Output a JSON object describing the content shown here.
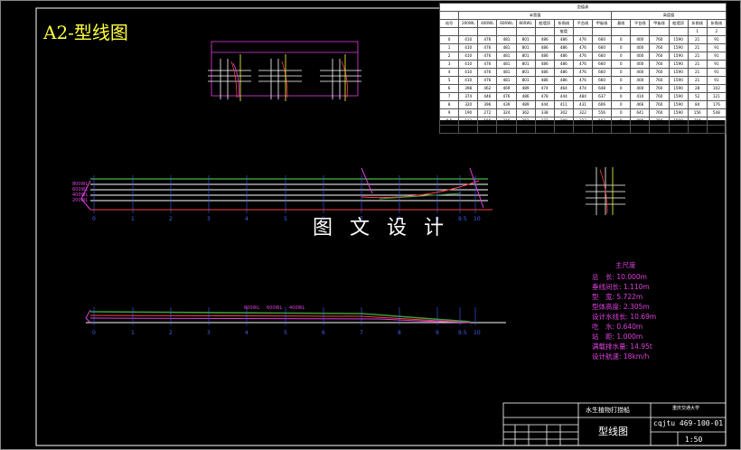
{
  "sheet_title": "A2-型线图",
  "watermark": "图 文 设 计",
  "offsets_table": {
    "title": "型值表",
    "group_left": "半宽值",
    "group_right": "高度值",
    "headers": [
      "站号",
      "200WL",
      "400WL",
      "600WL",
      "800WL",
      "舷墙顶",
      "折角线",
      "平台线",
      "甲板线",
      "基线",
      "平台线",
      "甲板线",
      "舷墙顶",
      "折角线",
      "折角线"
    ],
    "headers2": [
      "",
      "",
      "",
      "",
      "",
      "",
      "舷墙",
      "",
      "",
      "",
      "",
      "",
      "",
      "1",
      "2"
    ],
    "rows": [
      [
        "0",
        "410",
        "476",
        "481",
        "801",
        "486",
        "486",
        "476",
        "660",
        "0",
        "400",
        "760",
        "1590",
        "21",
        "91"
      ],
      [
        "1",
        "410",
        "476",
        "481",
        "801",
        "486",
        "486",
        "476",
        "660",
        "0",
        "400",
        "760",
        "1590",
        "21",
        "91"
      ],
      [
        "2",
        "410",
        "476",
        "481",
        "801",
        "486",
        "486",
        "476",
        "660",
        "0",
        "400",
        "760",
        "1590",
        "21",
        "91"
      ],
      [
        "3",
        "410",
        "476",
        "481",
        "801",
        "486",
        "486",
        "476",
        "660",
        "0",
        "400",
        "760",
        "1590",
        "21",
        "91"
      ],
      [
        "4",
        "410",
        "476",
        "481",
        "801",
        "486",
        "486",
        "476",
        "660",
        "0",
        "400",
        "760",
        "1590",
        "21",
        "91"
      ],
      [
        "5",
        "410",
        "476",
        "481",
        "801",
        "486",
        "486",
        "476",
        "660",
        "0",
        "400",
        "760",
        "1590",
        "21",
        "91"
      ],
      [
        "6",
        "398",
        "462",
        "469",
        "489",
        "474",
        "464",
        "474",
        "648",
        "0",
        "400",
        "760",
        "1590",
        "28",
        "102"
      ],
      [
        "7",
        "374",
        "446",
        "476",
        "486",
        "478",
        "444",
        "484",
        "637",
        "0",
        "410",
        "760",
        "1590",
        "52",
        "121"
      ],
      [
        "8",
        "320",
        "396",
        "439",
        "489",
        "444",
        "411",
        "431",
        "606",
        "0",
        "466",
        "760",
        "1590",
        "84",
        "176"
      ],
      [
        "9",
        "190",
        "272",
        "324",
        "362",
        "338",
        "302",
        "322",
        "556",
        "0",
        "641",
        "760",
        "1590",
        "156",
        "548"
      ],
      [
        "9.5",
        "113",
        "166",
        "216",
        "262",
        "277",
        "209",
        "223",
        "503",
        "0",
        "886",
        "760",
        "1590",
        "204",
        ""
      ],
      [
        "10",
        "20",
        "40",
        "60",
        "79",
        "98",
        "85",
        "95",
        "452",
        "0",
        "870",
        "760",
        "1590",
        "",
        ""
      ]
    ]
  },
  "main_dims": {
    "title": "主尺度",
    "items": [
      {
        "label": "总　长:",
        "value": "10.000m"
      },
      {
        "label": "垂线间长:",
        "value": "1.110m"
      },
      {
        "label": "型　宽:",
        "value": "5.722m"
      },
      {
        "label": "型体高度:",
        "value": "2.305m"
      },
      {
        "label": "设计水线长:",
        "value": "10.69m"
      },
      {
        "label": "吃　水:",
        "value": "0.640m"
      },
      {
        "label": "站　距:",
        "value": "1.000m"
      },
      {
        "label": "满载排水量:",
        "value": "14.95t"
      },
      {
        "label": "设计航速:",
        "value": "18km/h"
      }
    ]
  },
  "station_labels": [
    "0",
    "1",
    "2",
    "3",
    "4",
    "5",
    "6",
    "7",
    "8",
    "9",
    "9.5",
    "10"
  ],
  "waterline_labels": [
    "800WL",
    "600WL",
    "400WL",
    "200WL"
  ],
  "plan_labels": [
    "800WL",
    "600WL",
    "400WL"
  ],
  "title_block": {
    "project": "水生植物打捞船",
    "drawing_name": "型线图",
    "drawing_no": "cqjtu 469-100-01",
    "scale": "1:50",
    "school": "重庆交通大学"
  },
  "colors": {
    "frame": "#ffffff",
    "deck": "#3a9a3a",
    "hull": "#ff4040",
    "annot": "#e040e0",
    "station": "#4060ff",
    "text": "#ffff40",
    "spec": "#e040e0"
  }
}
